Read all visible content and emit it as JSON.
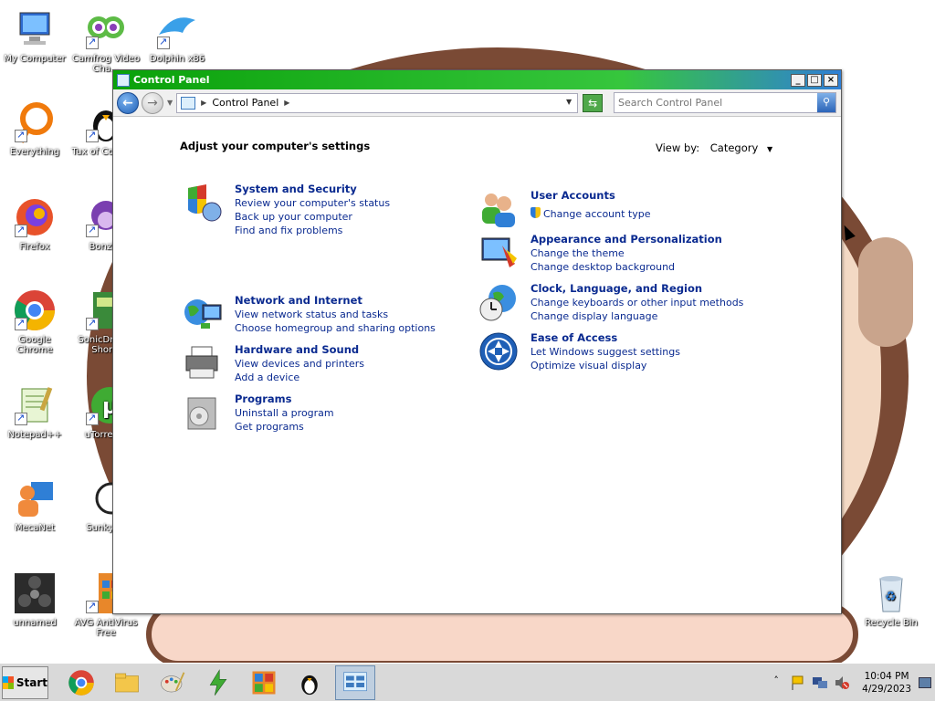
{
  "desktop": {
    "icons": [
      {
        "label": "My Computer"
      },
      {
        "label": "Camfrog Video Cha..."
      },
      {
        "label": "Dolphin x86"
      },
      {
        "label": "Everything"
      },
      {
        "label": "Tux of Comm..."
      },
      {
        "label": "Firefox"
      },
      {
        "label": "Bonzi..."
      },
      {
        "label": "Google Chrome"
      },
      {
        "label": "SonicDre... - Shor..."
      },
      {
        "label": "Notepad++"
      },
      {
        "label": "uTorren..."
      },
      {
        "label": "MecaNet"
      },
      {
        "label": "Sunky-..."
      },
      {
        "label": "unnamed"
      },
      {
        "label": "AVG AntiVirus Free"
      },
      {
        "label": "Recycle Bin"
      }
    ]
  },
  "window": {
    "title": "Control Panel",
    "controls": {
      "minimize": "_",
      "maximize": "□",
      "close": "×"
    },
    "address": {
      "crumb": "Control Panel"
    },
    "search": {
      "placeholder": "Search Control Panel"
    }
  },
  "content": {
    "heading": "Adjust your computer's settings",
    "view_by_label": "View by:",
    "view_by_value": "Category",
    "left_categories": [
      {
        "title": "System and Security",
        "links": [
          "Review your computer's status",
          "Back up your computer",
          "Find and fix problems"
        ]
      },
      {
        "title": "Network and Internet",
        "links": [
          "View network status and tasks",
          "Choose homegroup and sharing options"
        ]
      },
      {
        "title": "Hardware and Sound",
        "links": [
          "View devices and printers",
          "Add a device"
        ]
      },
      {
        "title": "Programs",
        "links": [
          "Uninstall a program",
          "Get programs"
        ]
      }
    ],
    "right_categories": [
      {
        "title": "User Accounts",
        "links": [
          "Change account type"
        ]
      },
      {
        "title": "Appearance and Personalization",
        "links": [
          "Change the theme",
          "Change desktop background"
        ]
      },
      {
        "title": "Clock, Language, and Region",
        "links": [
          "Change keyboards or other input methods",
          "Change display language"
        ]
      },
      {
        "title": "Ease of Access",
        "links": [
          "Let Windows suggest settings",
          "Optimize visual display"
        ]
      }
    ]
  },
  "taskbar": {
    "start_label": "Start",
    "clock_time": "10:04 PM",
    "clock_date": "4/29/2023",
    "tray_expand": "˄"
  }
}
